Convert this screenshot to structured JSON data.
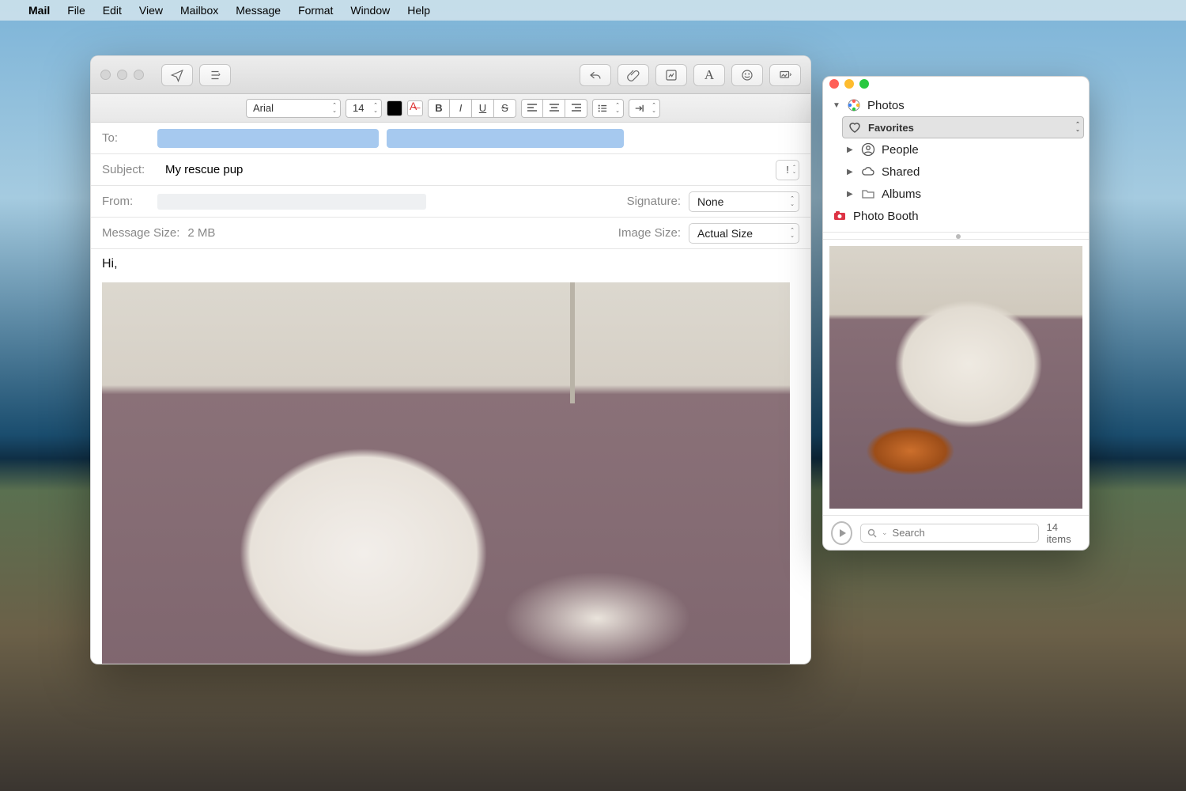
{
  "menubar": {
    "app": "Mail",
    "items": [
      "File",
      "Edit",
      "View",
      "Mailbox",
      "Message",
      "Format",
      "Window",
      "Help"
    ]
  },
  "toolbar": {
    "send": "Send",
    "list": "List",
    "reply": "Reply",
    "attach": "Attach",
    "markup": "Markup",
    "format": "Show Format",
    "emoji": "Emoji",
    "media": "Photo Browser"
  },
  "format": {
    "font": "Arial",
    "size": "14",
    "color": "#000000",
    "bold": "B",
    "italic": "I",
    "underline": "U",
    "strike": "S",
    "alignL": "≡",
    "alignC": "≡",
    "alignR": "≡",
    "bullets": "≣",
    "indentIn": "→|",
    "indentOut": "|←"
  },
  "headers": {
    "toLabel": "To:",
    "subjectLabel": "Subject:",
    "fromLabel": "From:",
    "signatureLabel": "Signature:",
    "messageSizeLabel": "Message Size:",
    "imageSizeLabel": "Image Size:",
    "subject": "My rescue pup",
    "signature": "None",
    "messageSize": "2 MB",
    "imageSize": "Actual Size",
    "priority": "!"
  },
  "body": {
    "greeting": "Hi,"
  },
  "photos": {
    "root": "Photos",
    "items": [
      {
        "label": "Favorites",
        "selected": true,
        "icon": "heart"
      },
      {
        "label": "People",
        "icon": "person"
      },
      {
        "label": "Shared",
        "icon": "cloud"
      },
      {
        "label": "Albums",
        "icon": "folder"
      }
    ],
    "photoBooth": "Photo Booth",
    "searchPlaceholder": "Search",
    "count": "14 items"
  }
}
